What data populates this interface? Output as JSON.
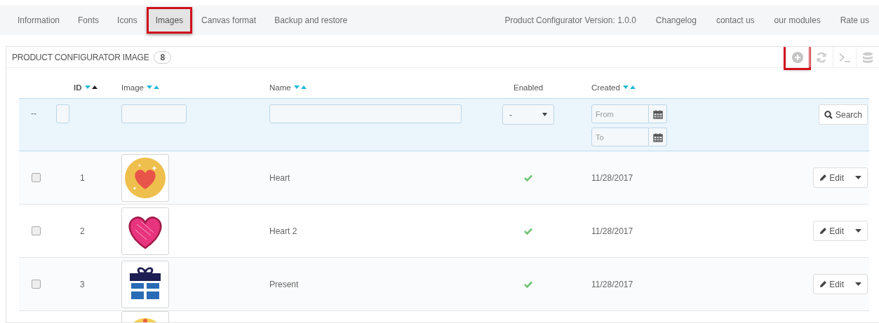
{
  "nav": {
    "tabs": [
      {
        "label": "Information",
        "selected": false,
        "highlighted": false
      },
      {
        "label": "Fonts",
        "selected": false,
        "highlighted": false
      },
      {
        "label": "Icons",
        "selected": false,
        "highlighted": false
      },
      {
        "label": "Images",
        "selected": true,
        "highlighted": true
      },
      {
        "label": "Canvas format",
        "selected": false,
        "highlighted": false
      },
      {
        "label": "Backup and restore",
        "selected": false,
        "highlighted": false
      }
    ],
    "links": [
      "Product Configurator Version: 1.0.0",
      "Changelog",
      "contact us",
      "our modules",
      "Rate us"
    ]
  },
  "panel": {
    "title": "PRODUCT CONFIGURATOR IMAGE",
    "count": "8",
    "toolbar": [
      {
        "kind": "add",
        "highlighted": true
      },
      {
        "kind": "refresh",
        "highlighted": false
      },
      {
        "kind": "terminal",
        "highlighted": false
      },
      {
        "kind": "database",
        "highlighted": false
      }
    ]
  },
  "table": {
    "columns": [
      {
        "label": "ID",
        "sortable": true,
        "sorted": true
      },
      {
        "label": "Image",
        "sortable": true,
        "sorted": false
      },
      {
        "label": "Name",
        "sortable": true,
        "sorted": false
      },
      {
        "label": "Enabled",
        "sortable": false,
        "sorted": false
      },
      {
        "label": "Created",
        "sortable": true,
        "sorted": false
      }
    ],
    "filters": {
      "bulk": "--",
      "enabled_select": "-",
      "from_placeholder": "From",
      "to_placeholder": "To",
      "search": "Search"
    },
    "rows": [
      {
        "checked": false,
        "id": "1",
        "name": "Heart",
        "enabled": true,
        "created": "11/28/2017",
        "action": "Edit"
      },
      {
        "checked": false,
        "id": "2",
        "name": "Heart 2",
        "enabled": true,
        "created": "11/28/2017",
        "action": "Edit"
      },
      {
        "checked": false,
        "id": "3",
        "name": "Present",
        "enabled": true,
        "created": "11/28/2017",
        "action": "Edit"
      }
    ]
  }
}
